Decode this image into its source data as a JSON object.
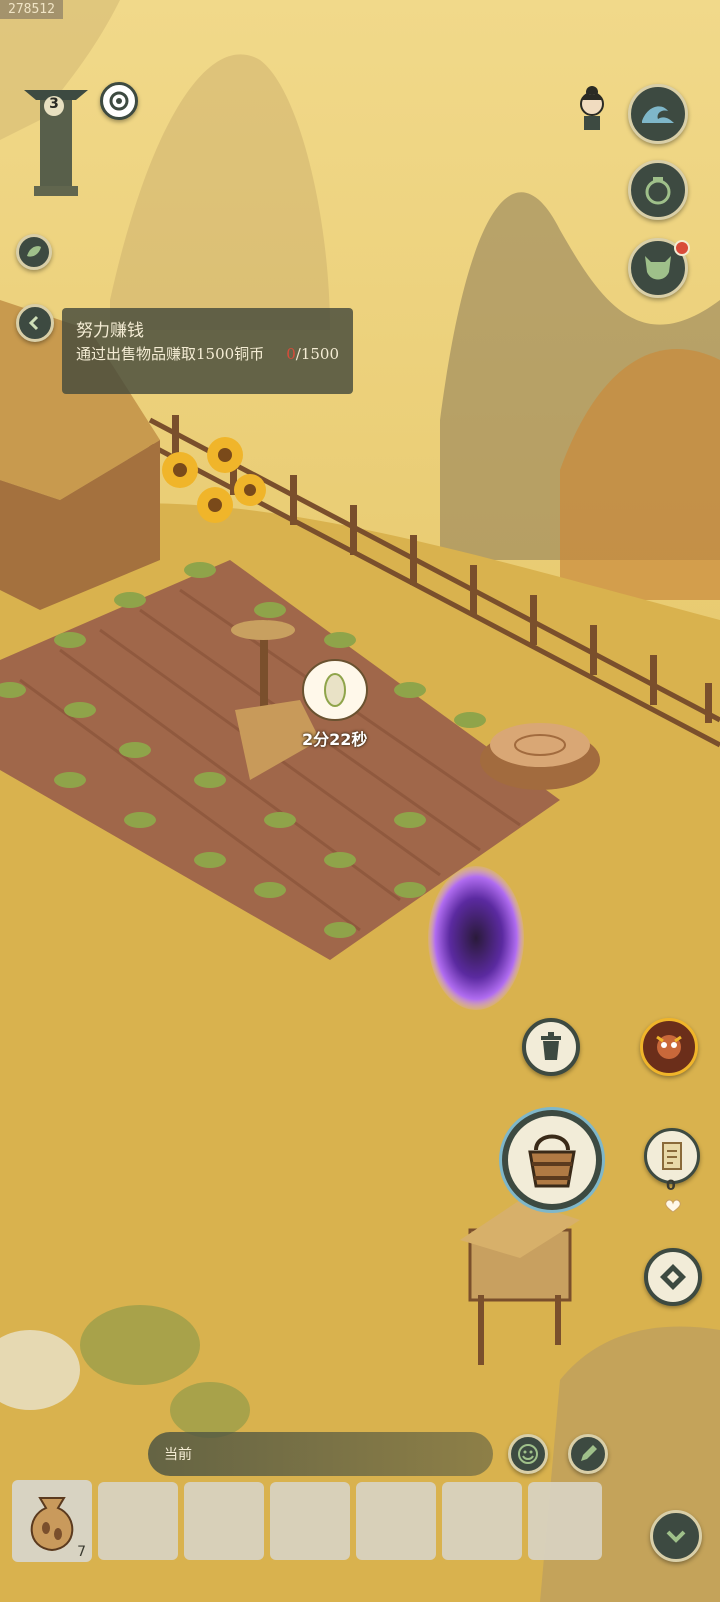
{
  "session_id": "278512",
  "level_badge": "3",
  "quest": {
    "title": "努力赚钱",
    "description": "通过出售物品赚取1500铜币",
    "progress_current": "0",
    "progress_total": "/1500"
  },
  "crop_timer": "2分22秒",
  "chat": {
    "placeholder": "当前"
  },
  "inventory": {
    "seed_bag_count": "7",
    "slot_count": 6
  },
  "scroll_count": "0",
  "icons": {
    "top_right": [
      "character-portrait-icon",
      "wave-skill-icon",
      "bag-pouch-icon",
      "monster-mask-icon"
    ],
    "right_side": [
      "trash-bin-icon",
      "angry-spirit-icon",
      "bucket-icon",
      "map-scroll-icon",
      "diamond-compass-icon"
    ],
    "bottom": [
      "emote-icon",
      "edit-icon",
      "collapse-icon"
    ]
  },
  "colors": {
    "button_bg": "#3d4a41",
    "button_ring": "#d9cfa8",
    "accent_red": "#d94b3a"
  }
}
